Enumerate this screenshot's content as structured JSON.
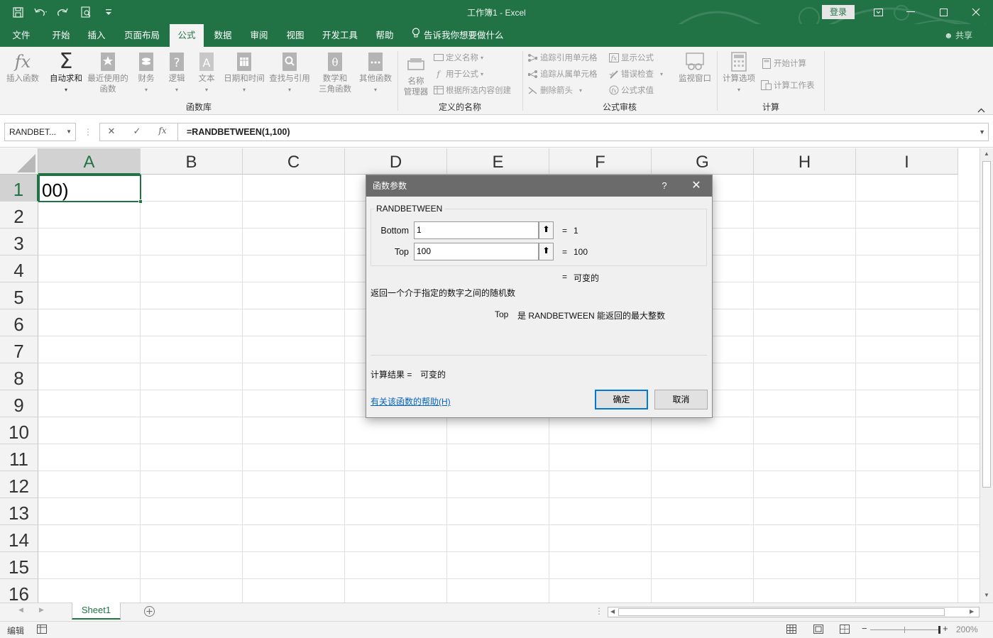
{
  "window": {
    "title": "工作簿1  -  Excel",
    "login_label": "登录",
    "share_label": "共享"
  },
  "tabs": [
    {
      "label": "文件"
    },
    {
      "label": "开始"
    },
    {
      "label": "插入"
    },
    {
      "label": "页面布局"
    },
    {
      "label": "公式",
      "active": true
    },
    {
      "label": "数据"
    },
    {
      "label": "审阅"
    },
    {
      "label": "视图"
    },
    {
      "label": "开发工具"
    },
    {
      "label": "帮助"
    }
  ],
  "tell_me": "告诉我你想要做什么",
  "ribbon": {
    "function_library": {
      "group_label": "函数库",
      "insert_function": "插入函数",
      "autosum": "自动求和",
      "recent_1": "最近使用的",
      "recent_2": "函数",
      "financial": "财务",
      "logical": "逻辑",
      "text": "文本",
      "datetime": "日期和时间",
      "lookup": "查找与引用",
      "math_1": "数学和",
      "math_2": "三角函数",
      "more": "其他函数"
    },
    "defined_names": {
      "group_label": "定义的名称",
      "name_manager_1": "名称",
      "name_manager_2": "管理器",
      "define_name": "定义名称",
      "use_in_formula": "用于公式",
      "create_from_selection": "根据所选内容创建"
    },
    "auditing": {
      "group_label": "公式审核",
      "trace_precedents": "追踪引用单元格",
      "trace_dependents": "追踪从属单元格",
      "remove_arrows": "删除箭头",
      "show_formulas": "显示公式",
      "error_checking": "错误检查",
      "evaluate_formula": "公式求值",
      "watch_window": "监视窗口"
    },
    "calculation": {
      "group_label": "计算",
      "options": "计算选项",
      "calc_now": "开始计算",
      "calc_sheet": "计算工作表"
    }
  },
  "formula_bar": {
    "name_box": "RANDBET...",
    "cancel_glyph": "✕",
    "enter_glyph": "✓",
    "fx_glyph": "fx",
    "formula": "=RANDBETWEEN(1,100)"
  },
  "grid": {
    "columns": [
      "A",
      "B",
      "C",
      "D",
      "E",
      "F",
      "G",
      "H",
      "I"
    ],
    "rows": [
      "1",
      "2",
      "3",
      "4",
      "5",
      "6",
      "7",
      "8",
      "9",
      "10",
      "11",
      "12",
      "13",
      "14",
      "15",
      "16"
    ],
    "a1_value": "00)"
  },
  "sheets": {
    "active": "Sheet1"
  },
  "status": {
    "mode": "编辑",
    "zoom": "200%"
  },
  "dialog": {
    "title": "函数参数",
    "help_glyph": "?",
    "close_glyph": "✕",
    "function_name": "RANDBETWEEN",
    "args": [
      {
        "label": "Bottom",
        "value": "1",
        "result": "1"
      },
      {
        "label": "Top",
        "value": "100",
        "result": "100"
      }
    ],
    "equals": "=",
    "overall_result": "可变的",
    "description": "返回一个介于指定的数字之间的随机数",
    "arg_help_label": "Top",
    "arg_help_text": "是 RANDBETWEEN 能返回的最大整数",
    "calc_result_label": "计算结果 =",
    "calc_result_value": "可变的",
    "help_link": "有关该函数的帮助(H)",
    "ok_label": "确定",
    "cancel_label": "取消"
  },
  "colors": {
    "excel_green": "#217346",
    "dialog_title_bg": "#6b6b6b",
    "link_blue": "#0563c1"
  }
}
